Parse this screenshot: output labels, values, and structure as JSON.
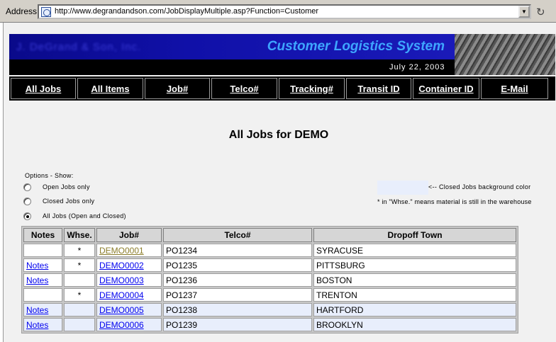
{
  "browser": {
    "address_label": "Address",
    "url": "http://www.degrandandson.com/JobDisplayMultiple.asp?Function=Customer"
  },
  "banner": {
    "company": "J. DeGrand & Son, Inc.",
    "title": "Customer Logistics System",
    "date": "July 22, 2003"
  },
  "nav": [
    "All Jobs",
    "All Items",
    "Job#",
    "Telco#",
    "Tracking#",
    "Transit ID",
    "Container ID",
    "E-Mail"
  ],
  "heading": "All Jobs for DEMO",
  "options": {
    "title": "Options - Show:",
    "items": [
      {
        "label": "Open Jobs only",
        "checked": false
      },
      {
        "label": "Closed Jobs only",
        "checked": false
      },
      {
        "label": "All Jobs (Open and Closed)",
        "checked": true
      }
    ]
  },
  "legend": {
    "closed_text": "<--  Closed Jobs background color",
    "closed_color": "#e8eefc",
    "whse_note": "* in \"Whse.\" means material is still in the warehouse"
  },
  "table": {
    "headers": [
      "Notes",
      "Whse.",
      "Job#",
      "Telco#",
      "Dropoff Town"
    ],
    "rows": [
      {
        "notes": "",
        "whse": "*",
        "job": "DEMO0001",
        "telco": "PO1234",
        "town": "SYRACUSE"
      },
      {
        "notes": "Notes",
        "whse": "*",
        "job": "DEMO0002",
        "telco": "PO1235",
        "town": "PITTSBURG"
      },
      {
        "notes": "Notes",
        "whse": "",
        "job": "DEMO0003",
        "telco": "PO1236",
        "town": "BOSTON"
      },
      {
        "notes": "",
        "whse": "*",
        "job": "DEMO0004",
        "telco": "PO1237",
        "town": "TRENTON"
      },
      {
        "notes": "Notes",
        "whse": "",
        "job": "DEMO0005",
        "telco": "PO1238",
        "town": "HARTFORD"
      },
      {
        "notes": "Notes",
        "whse": "",
        "job": "DEMO0006",
        "telco": "PO1239",
        "town": "BROOKLYN"
      }
    ]
  }
}
